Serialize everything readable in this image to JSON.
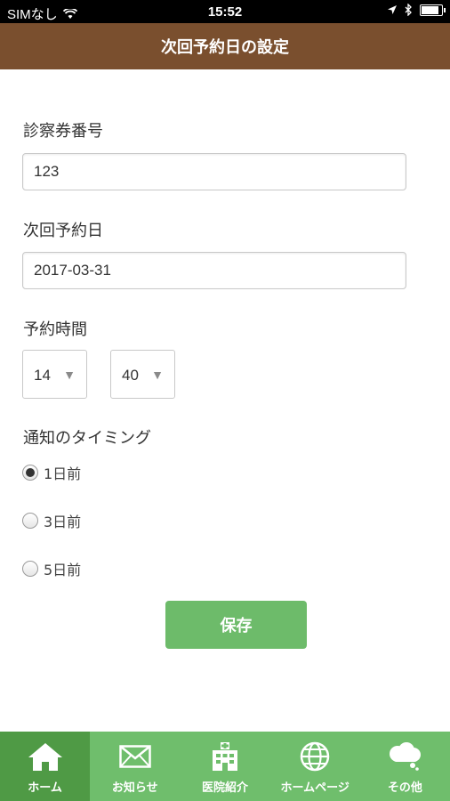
{
  "status_bar": {
    "carrier": "SIMなし",
    "time": "15:52"
  },
  "header": {
    "title": "次回予約日の設定"
  },
  "form": {
    "card_number_label": "診察券番号",
    "card_number_value": "123",
    "next_date_label": "次回予約日",
    "next_date_value": "2017-03-31",
    "time_label": "予約時間",
    "hour_value": "14",
    "minute_value": "40",
    "notify_label": "通知のタイミング",
    "notify_options": [
      {
        "label": "1日前",
        "checked": true
      },
      {
        "label": "3日前",
        "checked": false
      },
      {
        "label": "5日前",
        "checked": false
      }
    ],
    "save_label": "保存"
  },
  "tab_bar": {
    "items": [
      {
        "label": "ホーム",
        "icon": "home-icon",
        "active": true
      },
      {
        "label": "お知らせ",
        "icon": "mail-icon",
        "active": false
      },
      {
        "label": "医院紹介",
        "icon": "hospital-icon",
        "active": false
      },
      {
        "label": "ホームページ",
        "icon": "globe-icon",
        "active": false
      },
      {
        "label": "その他",
        "icon": "chat-cloud-icon",
        "active": false
      }
    ]
  },
  "colors": {
    "header_bg": "#7a4f2e",
    "accent_green": "#6dbb6a",
    "tab_active": "#4f9a45"
  }
}
